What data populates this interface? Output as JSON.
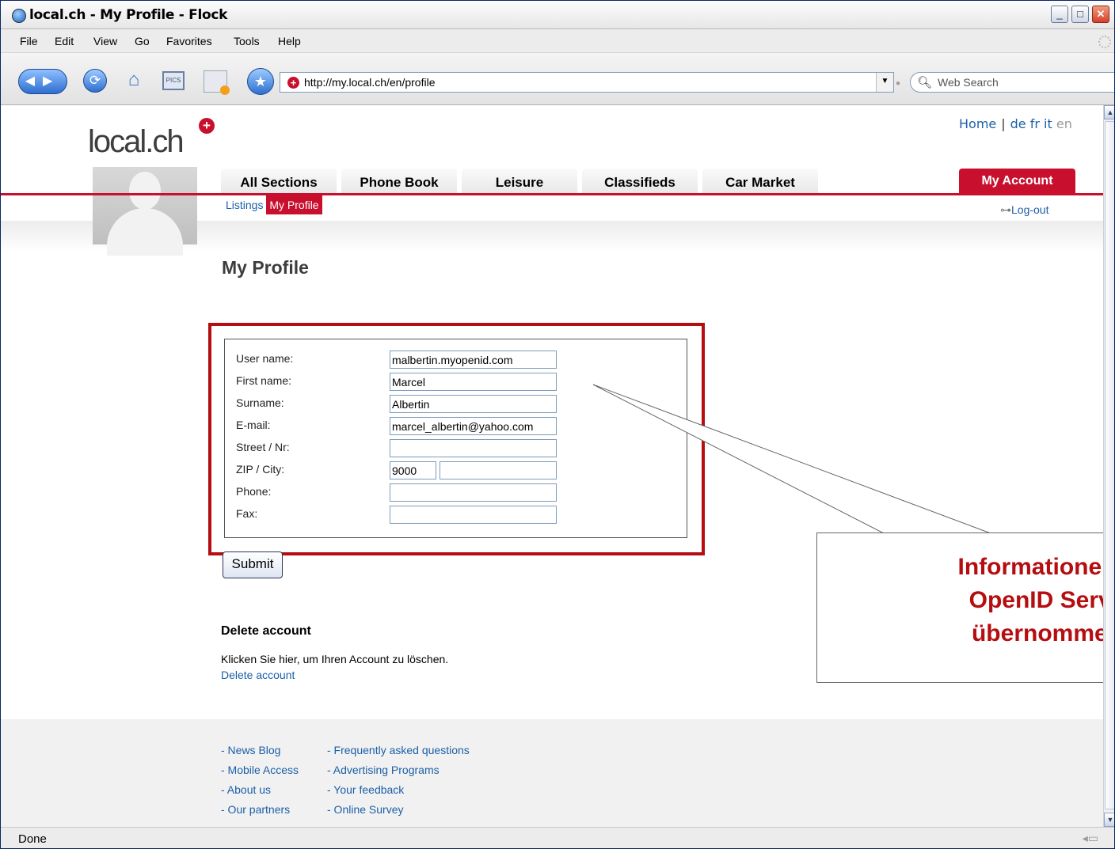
{
  "window": {
    "title": "local.ch - My Profile - Flock",
    "controls": {
      "minimize": "_",
      "maximize": "□",
      "close": "✕"
    }
  },
  "menu": [
    "File",
    "Edit",
    "View",
    "Go",
    "Favorites",
    "Tools",
    "Help"
  ],
  "toolbar": {
    "url": "http://my.local.ch/en/profile",
    "search_placeholder": "Web Search",
    "icons": [
      "back-forward-icon",
      "reload-icon",
      "home-icon",
      "pics-icon",
      "blog-icon",
      "star-icon"
    ]
  },
  "site": {
    "logo_text": "local.ch",
    "top_links": {
      "home": "Home",
      "de": "de",
      "fr": "fr",
      "it": "it",
      "en": "en"
    },
    "tabs": [
      "All Sections",
      "Phone Book",
      "Leisure",
      "Classifieds",
      "Car Market"
    ],
    "account_tab": "My Account",
    "subnav": {
      "listings": "Listings",
      "my_profile": "My Profile"
    },
    "logout": "Log-out",
    "accent": "#c8102e"
  },
  "profile": {
    "title": "My Profile",
    "fields": [
      {
        "label": "User name:",
        "value": "malbertin.myopenid.com"
      },
      {
        "label": "First name:",
        "value": "Marcel"
      },
      {
        "label": "Surname:",
        "value": "Albertin"
      },
      {
        "label": "E-mail:",
        "value": "marcel_albertin@yahoo.com"
      },
      {
        "label": "Street / Nr:",
        "value": ""
      },
      {
        "label": "ZIP / City:",
        "zip": "9000",
        "city": ""
      },
      {
        "label": "Phone:",
        "value": ""
      },
      {
        "label": "Fax:",
        "value": ""
      }
    ],
    "submit_label": "Submit"
  },
  "delete_section": {
    "heading": "Delete account",
    "text": "Klicken Sie hier, um Ihren Account zu löschen.",
    "link": "Delete account"
  },
  "footer": {
    "col1": [
      "- News Blog",
      "- Mobile Access",
      "- About us",
      "- Our partners"
    ],
    "col2": [
      "- Frequently asked questions",
      "- Advertising Programs",
      "- Your feedback",
      "- Online Survey"
    ]
  },
  "callout": {
    "line1": "Informationen a",
    "line2": "OpenID Serve",
    "line3": "übernommen"
  },
  "status": {
    "text": "Done"
  }
}
